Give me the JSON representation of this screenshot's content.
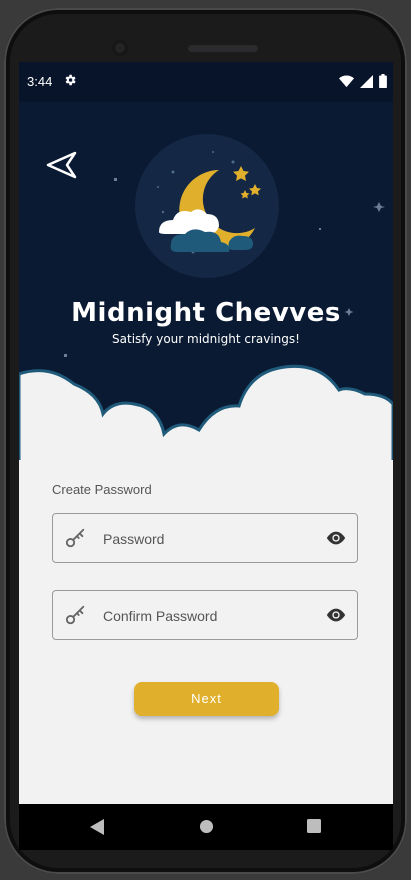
{
  "status_bar": {
    "time": "3:44",
    "icons": [
      "gear-icon",
      "wifi-icon",
      "signal-icon",
      "battery-icon"
    ]
  },
  "header": {
    "back_icon": "send-arrow-icon",
    "logo": "moon-cloud-stars-logo",
    "title": "Midnight Chevves",
    "subtitle": "Satisfy your midnight cravings!"
  },
  "form": {
    "section_label": "Create Password",
    "password": {
      "placeholder": "Password",
      "value": ""
    },
    "confirm_password": {
      "placeholder": "Confirm Password",
      "value": ""
    },
    "next_label": "Next"
  },
  "nav_bar": {
    "icons": [
      "back-triangle-icon",
      "home-circle-icon",
      "recents-square-icon"
    ]
  },
  "colors": {
    "hero_bg": "#0a1a33",
    "accent": "#e0b02d",
    "cloud_outline": "#1f5a7a",
    "screen_bg": "#f2f2f2"
  }
}
